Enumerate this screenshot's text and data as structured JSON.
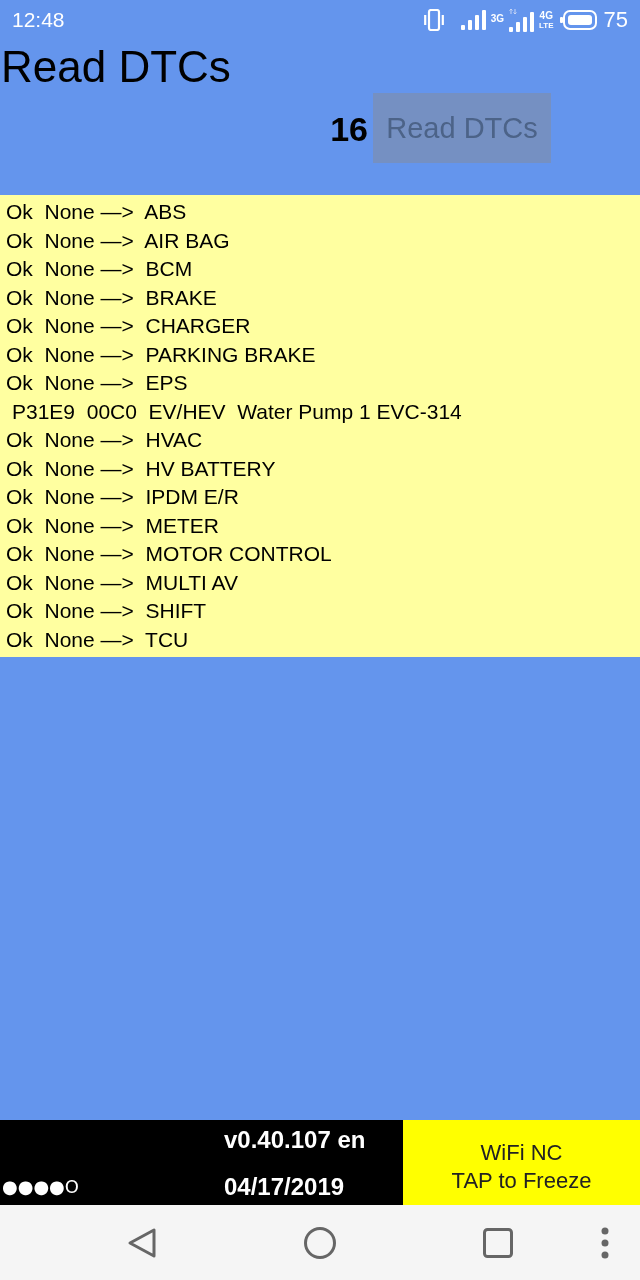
{
  "status_bar": {
    "time": "12:48",
    "network_1": "3G",
    "network_2": "4G",
    "network_2_sub": "LTE",
    "battery_percent": "75"
  },
  "header": {
    "title": "Read DTCs",
    "count": "16",
    "button": {
      "label": "Read DTCs",
      "disabled": true
    }
  },
  "results": [
    {
      "kind": "status",
      "text": "Ok  None —>  ABS"
    },
    {
      "kind": "status",
      "text": "Ok  None —>  AIR BAG"
    },
    {
      "kind": "status",
      "text": "Ok  None —>  BCM"
    },
    {
      "kind": "status",
      "text": "Ok  None —>  BRAKE"
    },
    {
      "kind": "status",
      "text": "Ok  None —>  CHARGER"
    },
    {
      "kind": "status",
      "text": "Ok  None —>  PARKING BRAKE"
    },
    {
      "kind": "status",
      "text": "Ok  None —>  EPS"
    },
    {
      "kind": "fault",
      "text": "P31E9  00C0  EV/HEV  Water Pump 1 EVC-314"
    },
    {
      "kind": "status",
      "text": "Ok  None —>  HVAC"
    },
    {
      "kind": "status",
      "text": "Ok  None —>  HV BATTERY"
    },
    {
      "kind": "status",
      "text": "Ok  None —>  IPDM E/R"
    },
    {
      "kind": "status",
      "text": "Ok  None —>  METER"
    },
    {
      "kind": "status",
      "text": "Ok  None —>  MOTOR CONTROL"
    },
    {
      "kind": "status",
      "text": "Ok  None —>  MULTI AV"
    },
    {
      "kind": "status",
      "text": "Ok  None —>  SHIFT"
    },
    {
      "kind": "status",
      "text": "Ok  None —>  TCU"
    }
  ],
  "footer": {
    "progress": "●●●●O",
    "version": "v0.40.107 en",
    "date": "04/17/2019",
    "wifi_button": {
      "lines": [
        "WiFi NC",
        "TAP to Freeze"
      ]
    }
  }
}
